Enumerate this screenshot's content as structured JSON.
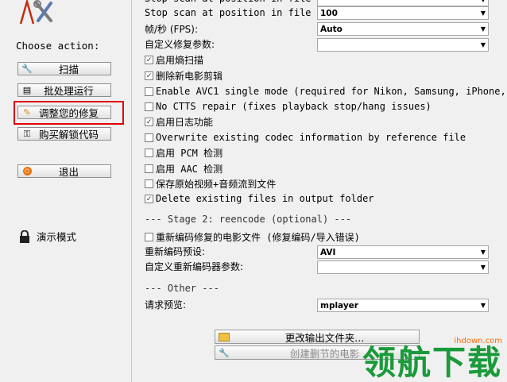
{
  "sidebar": {
    "choose_label": "Choose action:",
    "buttons": [
      {
        "label": "扫描",
        "icon": "wrench-icon"
      },
      {
        "label": "批处理运行",
        "icon": "document-icon"
      },
      {
        "label": "调整您的修复",
        "icon": "pencil-icon"
      },
      {
        "label": "购买解锁代码",
        "icon": "key-icon"
      },
      {
        "label": "退出",
        "icon": "power-icon"
      }
    ],
    "demo_label": "演示模式"
  },
  "main": {
    "stop_scan_label": "Stop scan at position in file",
    "stop_scan_value": "100",
    "fps_label": "帧/秒 (FPS):",
    "fps_value": "Auto",
    "custom_params_label": "自定义修复参数:",
    "checks": [
      {
        "label": "启用熵扫描",
        "checked": true
      },
      {
        "label": "删除新电影剪辑",
        "checked": true
      },
      {
        "label": "Enable AVC1 single mode (required for Nikon, Samsung, iPhone,",
        "checked": false
      },
      {
        "label": "No CTTS repair (fixes playback stop/hang issues)",
        "checked": false
      },
      {
        "label": "启用日志功能",
        "checked": true
      },
      {
        "label": "Overwrite existing codec information by reference file",
        "checked": false
      },
      {
        "label": "启用 PCM 检测",
        "checked": false
      },
      {
        "label": "启用 AAC 检测",
        "checked": false
      },
      {
        "label": "保存原始视频+音频流到文件",
        "checked": false
      },
      {
        "label": "Delete existing files in output folder",
        "checked": true
      }
    ],
    "stage2_header": "--- Stage 2: reencode (optional) ---",
    "reencode_label": "重新编码修复的电影文件 (修复编码/导入错误)",
    "reencode_checked": false,
    "preset_label": "重新编码预设:",
    "preset_value": "AVI",
    "reencoder_params_label": "自定义重新编码器参数:",
    "other_header": "--- Other ---",
    "preview_label": "请求预览:",
    "preview_value": "mplayer",
    "change_output_label": "更改输出文件夹...",
    "create_clip_label": "创建删节的电影"
  },
  "watermark": {
    "site": "ihdown.com",
    "text": "领航下载"
  },
  "colors": {
    "highlight": "#e00000",
    "watermark_green": "#1a9a3a",
    "watermark_orange": "#ff6a00"
  }
}
